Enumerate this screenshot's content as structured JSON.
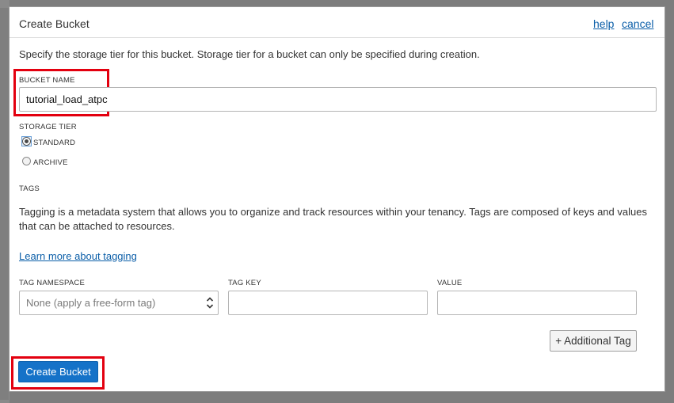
{
  "dialog": {
    "title": "Create Bucket",
    "help_label": "help",
    "cancel_label": "cancel"
  },
  "description": "Specify the storage tier for this bucket. Storage tier for a bucket can only be specified during creation.",
  "bucket_name": {
    "label": "BUCKET NAME",
    "value": "tutorial_load_atpc"
  },
  "storage_tier": {
    "label": "STORAGE TIER",
    "options": [
      "STANDARD",
      "ARCHIVE"
    ],
    "selected": "STANDARD"
  },
  "tags": {
    "label": "TAGS",
    "description": "Tagging is a metadata system that allows you to organize and track resources within your tenancy. Tags are composed of keys and values that can be attached to resources.",
    "learn_more": "Learn more about tagging",
    "namespace_label": "TAG NAMESPACE",
    "namespace_value": "None (apply a free-form tag)",
    "key_label": "TAG KEY",
    "key_value": "",
    "value_label": "VALUE",
    "value_value": "",
    "additional_tag_label": "+ Additional Tag"
  },
  "create_button_label": "Create Bucket",
  "highlight_color": "#e3000f",
  "primary_color": "#1572c8",
  "link_color": "#0b5ea8"
}
